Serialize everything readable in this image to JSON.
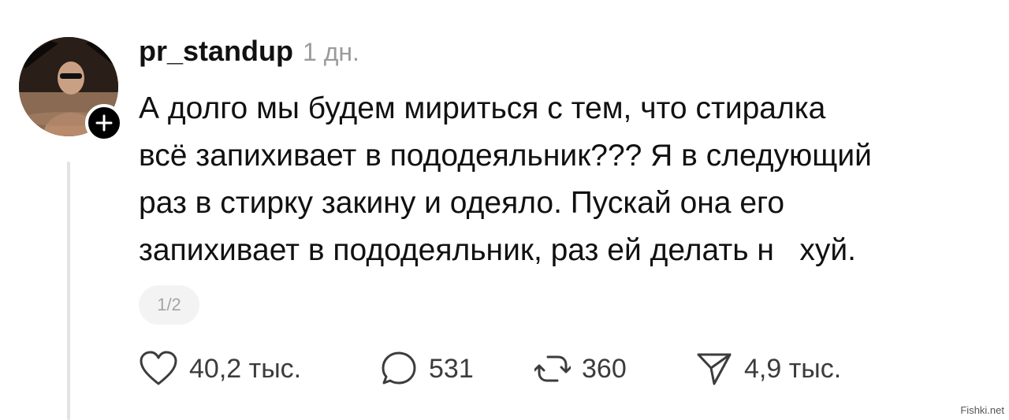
{
  "post": {
    "username": "pr_standup",
    "time": "1 дн.",
    "text_lines": [
      "А долго мы будем мириться с тем, что стиралка",
      "всё запихивает в пододеяльник??? Я в следующий",
      "раз в стирку закину и одеяло. Пускай она его",
      "запихивает в пододеяльник, раз ей делать н   хуй."
    ],
    "media_pager": "1/2"
  },
  "actions": {
    "likes": "40,2 тыс.",
    "replies": "531",
    "reposts": "360",
    "shares": "4,9 тыс."
  },
  "icons": {
    "like": "heart-icon",
    "reply": "comment-bubble-icon",
    "repost": "repost-arrows-icon",
    "share": "paper-plane-icon",
    "follow": "plus-icon"
  },
  "watermark": "Fishki.net",
  "colors": {
    "text": "#111111",
    "muted": "#9b9b9b",
    "thread_line": "#e3e3e3",
    "badge": "#000000"
  }
}
